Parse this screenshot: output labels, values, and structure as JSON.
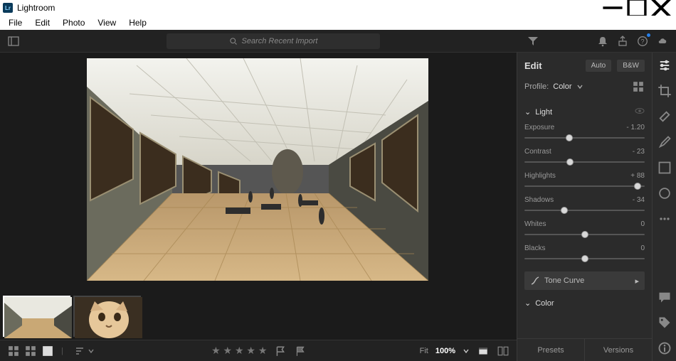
{
  "window": {
    "title": "Lightroom"
  },
  "menu": [
    "File",
    "Edit",
    "Photo",
    "View",
    "Help"
  ],
  "search": {
    "placeholder": "Search Recent Import"
  },
  "editPanel": {
    "title": "Edit",
    "auto": "Auto",
    "bw": "B&W",
    "profileLabel": "Profile:",
    "profileValue": "Color",
    "sections": {
      "light": {
        "label": "Light",
        "sliders": [
          {
            "label": "Exposure",
            "value": "- 1.20",
            "pos": 37
          },
          {
            "label": "Contrast",
            "value": "- 23",
            "pos": 38
          },
          {
            "label": "Highlights",
            "value": "+ 88",
            "pos": 94
          },
          {
            "label": "Shadows",
            "value": "- 34",
            "pos": 33
          },
          {
            "label": "Whites",
            "value": "0",
            "pos": 50
          },
          {
            "label": "Blacks",
            "value": "0",
            "pos": 50
          }
        ],
        "toneCurve": "Tone Curve"
      },
      "color": {
        "label": "Color"
      }
    },
    "presets": "Presets",
    "versions": "Versions"
  },
  "status": {
    "fitLabel": "Fit",
    "zoom": "100%"
  }
}
